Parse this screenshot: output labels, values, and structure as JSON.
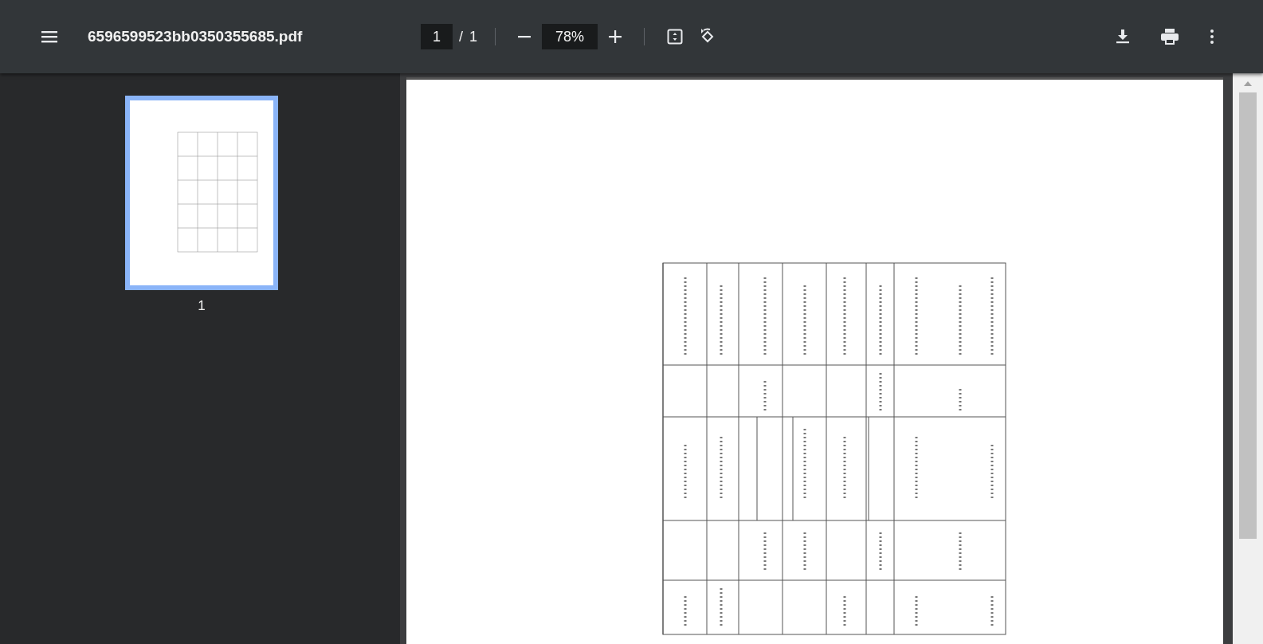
{
  "toolbar": {
    "title": "6596599523bb0350355685.pdf",
    "page_input": "1",
    "page_separator": "/",
    "page_total": "1",
    "zoom_value": "78%"
  },
  "thumbnails": [
    {
      "label": "1",
      "selected": true
    }
  ]
}
